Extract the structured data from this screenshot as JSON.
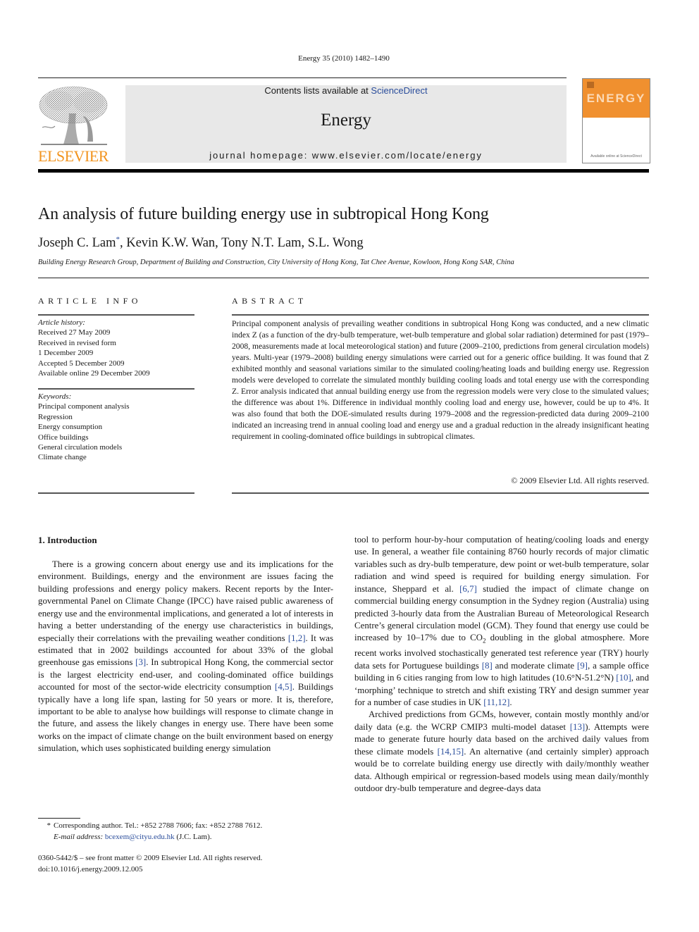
{
  "running_head": "Energy 35 (2010) 1482–1490",
  "masthead": {
    "contents_prefix": "Contents lists available at ",
    "contents_link": "ScienceDirect",
    "journal_name": "Energy",
    "homepage_label": "journal homepage: ",
    "homepage_url": "www.elsevier.com/locate/energy",
    "publisher_logo_text": "ELSEVIER",
    "cover_title": "ENERGY",
    "cover_footer": "Available online at ScienceDirect"
  },
  "colors": {
    "link": "#2a4d9b",
    "elsevier_orange": "#f2941f",
    "cover_orange": "#f0902f",
    "masthead_bg": "#e8e8e8"
  },
  "article": {
    "title": "An analysis of future building energy use in subtropical Hong Kong",
    "authors": [
      {
        "name": "Joseph C. Lam",
        "marker": "*"
      },
      {
        "name": "Kevin K.W. Wan"
      },
      {
        "name": "Tony N.T. Lam"
      },
      {
        "name": "S.L. Wong"
      }
    ],
    "authors_rest": ", Kevin K.W. Wan, Tony N.T. Lam, S.L. Wong",
    "affiliation": "Building Energy Research Group, Department of Building and Construction, City University of Hong Kong, Tat Chee Avenue, Kowloon, Hong Kong SAR, China"
  },
  "article_info": {
    "heading": "ARTICLE INFO",
    "history_label": "Article history:",
    "history": [
      "Received 27 May 2009",
      "Received in revised form",
      "1 December 2009",
      "Accepted 5 December 2009",
      "Available online 29 December 2009"
    ],
    "keywords_label": "Keywords:",
    "keywords": [
      "Principal component analysis",
      "Regression",
      "Energy consumption",
      "Office buildings",
      "General circulation models",
      "Climate change"
    ]
  },
  "abstract": {
    "heading": "ABSTRACT",
    "text": "Principal component analysis of prevailing weather conditions in subtropical Hong Kong was conducted, and a new climatic index Z (as a function of the dry-bulb temperature, wet-bulb temperature and global solar radiation) determined for past (1979–2008, measurements made at local meteorological station) and future (2009–2100, predictions from general circulation models) years. Multi-year (1979–2008) building energy simulations were carried out for a generic office building. It was found that Z exhibited monthly and seasonal variations similar to the simulated cooling/heating loads and building energy use. Regression models were developed to correlate the simulated monthly building cooling loads and total energy use with the corresponding Z. Error analysis indicated that annual building energy use from the regression models were very close to the simulated values; the difference was about 1%. Difference in individual monthly cooling load and energy use, however, could be up to 4%. It was also found that both the DOE-simulated results during 1979–2008 and the regression-predicted data during 2009–2100 indicated an increasing trend in annual cooling load and energy use and a gradual reduction in the already insignificant heating requirement in cooling-dominated office buildings in subtropical climates.",
    "copyright": "© 2009 Elsevier Ltd. All rights reserved."
  },
  "introduction": {
    "heading": "1.  Introduction",
    "left_col": {
      "p1": [
        {
          "t": "There is a growing concern about energy use and its implications for the environment. Buildings, energy and the environment are issues facing the building professions and energy policy makers. Recent reports by the Inter-governmental Panel on Climate Change (IPCC) have raised public awareness of energy use and the environmental implications, and generated a lot of interests in having a better understanding of the energy use characteristics in buildings, especially their correlations with the prevailing weather conditions "
        },
        {
          "ref": "[1,2]"
        },
        {
          "t": ". It was estimated that in 2002 buildings accounted for about 33% of the global greenhouse gas emissions "
        },
        {
          "ref": "[3]"
        },
        {
          "t": ". In subtropical Hong Kong, the commercial sector is the largest electricity end-user, and cooling-dominated office buildings accounted for most of the sector-wide electricity consumption "
        },
        {
          "ref": "[4,5]"
        },
        {
          "t": ". Buildings typically have a long life span, lasting for 50 years or more. It is, therefore, important to be able to analyse how buildings will response to climate change in the future, and assess the likely changes in energy use. There have been some works on the impact of climate change on the built environment based on energy simulation, which uses sophisticated building energy simulation"
        }
      ]
    },
    "right_col": {
      "p1": [
        {
          "t": "tool to perform hour-by-hour computation of heating/cooling loads and energy use. In general, a weather file containing 8760 hourly records of major climatic variables such as dry-bulb temperature, dew point or wet-bulb temperature, solar radiation and wind speed is required for building energy simulation. For instance, Sheppard et al. "
        },
        {
          "ref": "[6,7]"
        },
        {
          "t": " studied the impact of climate change on commercial building energy consumption in the Sydney region (Australia) using predicted 3-hourly data from the Australian Bureau of Meteorological Research Centre’s general circulation model (GCM). They found that energy use could be increased by 10–17% due to CO"
        },
        {
          "sub": "2"
        },
        {
          "t": " doubling in the global atmosphere. More recent works involved stochastically generated test reference year (TRY) hourly data sets for Portuguese buildings "
        },
        {
          "ref": "[8]"
        },
        {
          "t": " and moderate climate "
        },
        {
          "ref": "[9]"
        },
        {
          "t": ", a sample office building in 6 cities ranging from low to high latitudes (10.6°N-51.2°N) "
        },
        {
          "ref": "[10]"
        },
        {
          "t": ", and ‘morphing’ technique to stretch and shift existing TRY and design summer year for a number of case studies in UK "
        },
        {
          "ref": "[11,12]"
        },
        {
          "t": "."
        }
      ],
      "p2": [
        {
          "t": "Archived predictions from GCMs, however, contain mostly monthly and/or daily data (e.g. the WCRP CMIP3 multi-model dataset "
        },
        {
          "ref": "[13]"
        },
        {
          "t": "). Attempts were made to generate future hourly data based on the archived daily values from these climate models "
        },
        {
          "ref": "[14,15]"
        },
        {
          "t": ". An alternative (and certainly simpler) approach would be to correlate building energy use directly with daily/monthly weather data. Although empirical or regression-based models using mean daily/monthly outdoor dry-bulb temperature and degree-days data"
        }
      ]
    }
  },
  "footnote": {
    "marker": "*",
    "corresponding": "Corresponding author. Tel.: +852 2788 7606; fax: +852 2788 7612.",
    "email_label": "E-mail address: ",
    "email": "bcexem@cityu.edu.hk",
    "email_suffix": " (J.C. Lam)."
  },
  "front_matter": {
    "issn_line": "0360-5442/$ – see front matter © 2009 Elsevier Ltd. All rights reserved.",
    "doi": "doi:10.1016/j.energy.2009.12.005"
  }
}
